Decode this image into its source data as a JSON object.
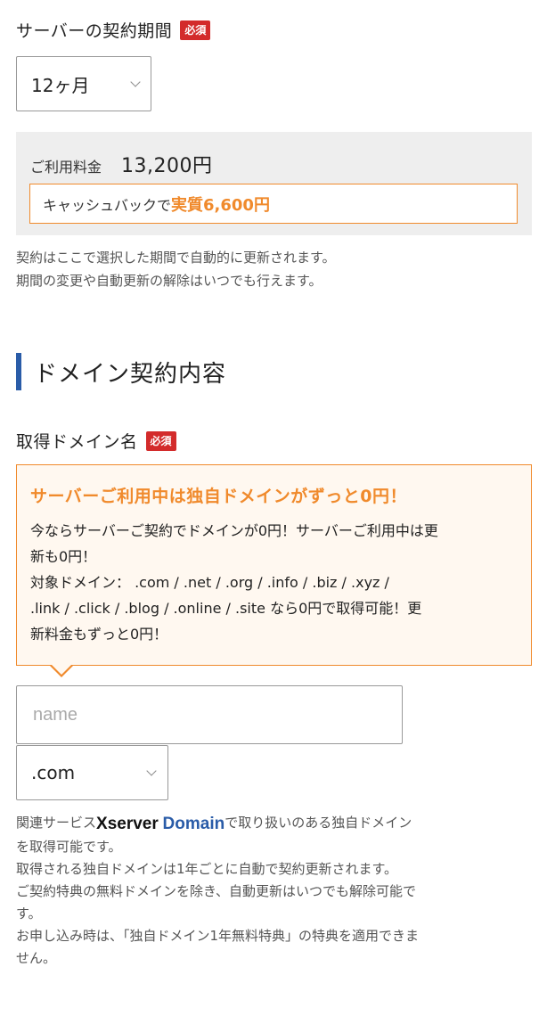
{
  "contract": {
    "label": "サーバーの契約期間",
    "required_badge": "必須",
    "selected_period": "12ヶ月",
    "price_label": "ご利用料金",
    "price_value": "13,200円",
    "cashback_prefix": "キャッシュバックで",
    "cashback_highlight": "実質6,600円",
    "note_line1": "契約はここで選択した期間で自動的に更新されます。",
    "note_line2": "期間の変更や自動更新の解除はいつでも行えます。"
  },
  "domain_section": {
    "title": "ドメイン契約内容",
    "label": "取得ドメイン名",
    "required_badge": "必須",
    "promo_title": "サーバーご利用中は独自ドメインがずっと0円！",
    "promo_line1": "今ならサーバーご契約でドメインが0円！サーバーご利用中は更",
    "promo_line2": "新も0円！",
    "promo_line3": "対象ドメイン： .com / .net / .org / .info / .biz / .xyz /",
    "promo_line4": ".link / .click / .blog / .online / .site なら0円で取得可能！更",
    "promo_line5": "新料金もずっと0円！",
    "name_placeholder": "name",
    "tld_selected": ".com",
    "info_prefix": "関連サービス",
    "info_brand": "Xserver",
    "info_brand2": "Domain",
    "info_suffix": "で取り扱いのある独自ドメイン",
    "info_line2": "を取得可能です。",
    "info_line3": "取得される独自ドメインは1年ごとに自動で契約更新されます。",
    "info_line4": "ご契約特典の無料ドメインを除き、自動更新はいつでも解除可能で",
    "info_line5": "す。",
    "info_line6": "お申し込み時は、「独自ドメイン1年無料特典」の特典を適用できま",
    "info_line7": "せん。"
  },
  "colors": {
    "accent_orange": "#f08a2c",
    "required_red": "#d32b2b",
    "section_blue": "#2a5ca8"
  }
}
